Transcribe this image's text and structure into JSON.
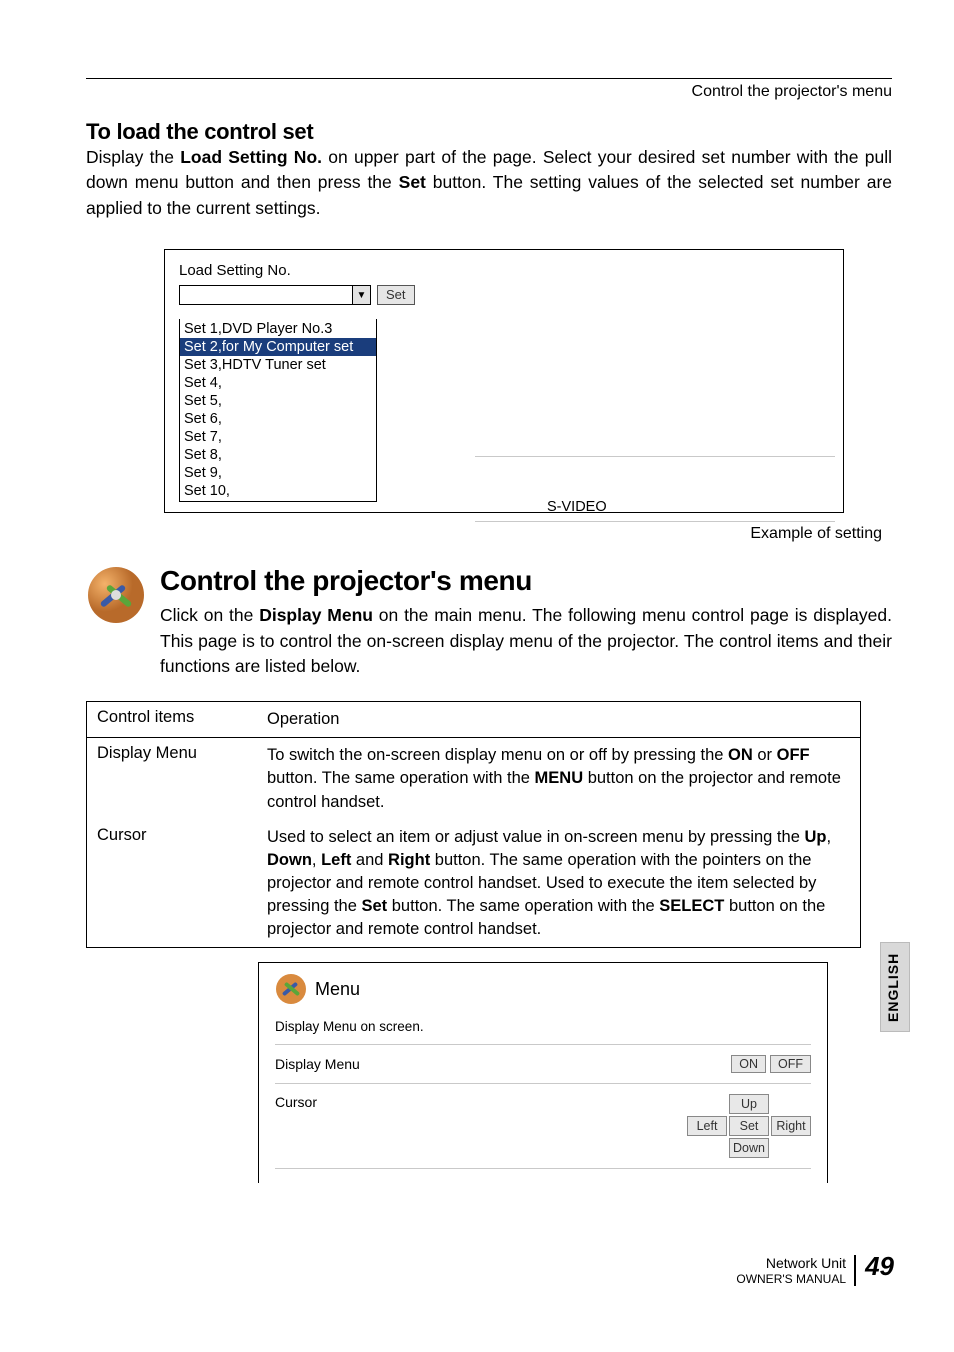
{
  "header": {
    "running": "Control the projector's menu"
  },
  "section1": {
    "title": "To load the control set",
    "para_1": "Display the ",
    "bold_1": "Load Setting No.",
    "para_2": " on upper part of the page. Select your desired set number with the pull down menu button and then press the ",
    "bold_2": "Set",
    "para_3": " button. The setting values of the selected set number are applied to the current settings."
  },
  "ui1": {
    "label": "Load Setting No.",
    "set_button": "Set",
    "options": [
      "Set 1,DVD Player No.3",
      "Set 2,for My Computer set",
      "Set 3,HDTV Tuner set",
      "Set 4,",
      "Set 5,",
      "Set 6,",
      "Set 7,",
      "Set 8,",
      "Set 9,",
      "Set 10,"
    ],
    "highlight_index": 1,
    "right_value": "S-VIDEO",
    "caption": "Example of setting"
  },
  "section2": {
    "title": "Control the projector's menu",
    "para_1": "Click on the ",
    "bold_1": "Display Menu",
    "para_2": " on the main menu. The following menu control page is displayed. This page is to control the on-screen display menu of the projector. The control items and their functions are listed below."
  },
  "table": {
    "h1": "Control items",
    "h2": "Operation",
    "rows": [
      {
        "c1": "Display Menu",
        "parts": [
          {
            "t": "To switch the on-screen display menu on or off by pressing the "
          },
          {
            "b": "ON"
          },
          {
            "t": " or "
          },
          {
            "b": "OFF"
          },
          {
            "t": " button. The same operation with the "
          },
          {
            "b": "MENU"
          },
          {
            "t": " button on the projector and remote control handset."
          }
        ]
      },
      {
        "c1": "Cursor",
        "parts": [
          {
            "t": "Used to select an item or adjust value in on-screen menu by pressing the "
          },
          {
            "b": "Up"
          },
          {
            "t": ", "
          },
          {
            "b": "Down"
          },
          {
            "t": ", "
          },
          {
            "b": "Left"
          },
          {
            "t": " and "
          },
          {
            "b": "Right"
          },
          {
            "t": " button. The same operation with the pointers on the projector and remote control handset. Used to execute the item selected by pressing the "
          },
          {
            "b": "Set"
          },
          {
            "t": " button. The same operation with the "
          },
          {
            "b": "SELECT"
          },
          {
            "t": " button on the projector and remote control handset."
          }
        ]
      }
    ]
  },
  "menu_ui": {
    "title": "Menu",
    "subtitle": "Display Menu on screen.",
    "row1_label": "Display Menu",
    "on": "ON",
    "off": "OFF",
    "row2_label": "Cursor",
    "up": "Up",
    "left": "Left",
    "set": "Set",
    "right": "Right",
    "down": "Down"
  },
  "side_tab": "ENGLISH",
  "footer": {
    "l1": "Network Unit",
    "l2": "OWNER'S MANUAL",
    "page": "49"
  }
}
